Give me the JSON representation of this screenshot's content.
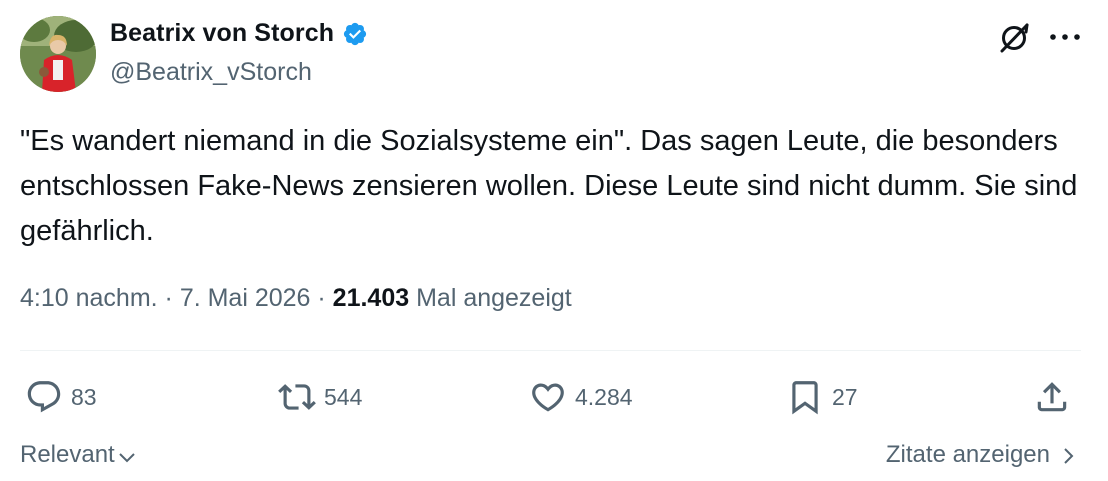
{
  "author": {
    "name": "Beatrix von Storch",
    "handle": "@Beatrix_vStorch"
  },
  "tweet": {
    "text": "\"Es wandert niemand in die Sozialsysteme ein\". Das sagen Leute, die besonders entschlossen Fake-News zensieren wollen. Diese Leute sind nicht dumm. Sie sind gefährlich.",
    "time": "4:10 nachm.",
    "sep1": " · ",
    "date": "7. Mai 2026",
    "sep2": " · ",
    "views_count": "21.403",
    "views_label": " Mal angezeigt"
  },
  "actions": {
    "replies": "83",
    "retweets": "544",
    "likes": "4.284",
    "bookmarks": "27"
  },
  "footer": {
    "sort_label": "Relevant",
    "quotes_label": "Zitate anzeigen"
  },
  "colors": {
    "text": "#0f1419",
    "secondary": "#536471",
    "verified": "#1d9bf0"
  },
  "icons": [
    "verified-badge-icon",
    "grok-icon",
    "more-icon",
    "reply-icon",
    "retweet-icon",
    "like-icon",
    "bookmark-icon",
    "share-icon",
    "chevron-down-icon",
    "chevron-right-icon"
  ]
}
